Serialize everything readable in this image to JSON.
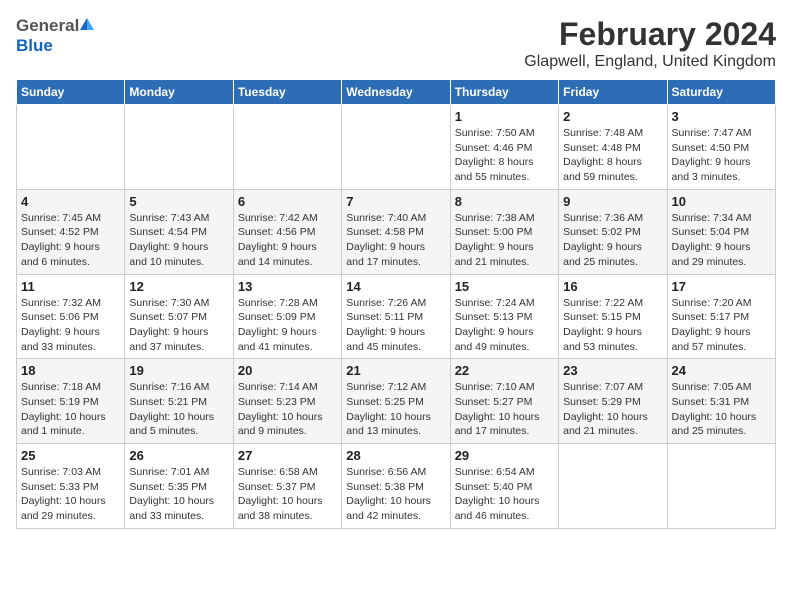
{
  "logo": {
    "general": "General",
    "blue": "Blue"
  },
  "title": "February 2024",
  "subtitle": "Glapwell, England, United Kingdom",
  "weekdays": [
    "Sunday",
    "Monday",
    "Tuesday",
    "Wednesday",
    "Thursday",
    "Friday",
    "Saturday"
  ],
  "weeks": [
    [
      {
        "day": "",
        "info": ""
      },
      {
        "day": "",
        "info": ""
      },
      {
        "day": "",
        "info": ""
      },
      {
        "day": "",
        "info": ""
      },
      {
        "day": "1",
        "info": "Sunrise: 7:50 AM\nSunset: 4:46 PM\nDaylight: 8 hours\nand 55 minutes."
      },
      {
        "day": "2",
        "info": "Sunrise: 7:48 AM\nSunset: 4:48 PM\nDaylight: 8 hours\nand 59 minutes."
      },
      {
        "day": "3",
        "info": "Sunrise: 7:47 AM\nSunset: 4:50 PM\nDaylight: 9 hours\nand 3 minutes."
      }
    ],
    [
      {
        "day": "4",
        "info": "Sunrise: 7:45 AM\nSunset: 4:52 PM\nDaylight: 9 hours\nand 6 minutes."
      },
      {
        "day": "5",
        "info": "Sunrise: 7:43 AM\nSunset: 4:54 PM\nDaylight: 9 hours\nand 10 minutes."
      },
      {
        "day": "6",
        "info": "Sunrise: 7:42 AM\nSunset: 4:56 PM\nDaylight: 9 hours\nand 14 minutes."
      },
      {
        "day": "7",
        "info": "Sunrise: 7:40 AM\nSunset: 4:58 PM\nDaylight: 9 hours\nand 17 minutes."
      },
      {
        "day": "8",
        "info": "Sunrise: 7:38 AM\nSunset: 5:00 PM\nDaylight: 9 hours\nand 21 minutes."
      },
      {
        "day": "9",
        "info": "Sunrise: 7:36 AM\nSunset: 5:02 PM\nDaylight: 9 hours\nand 25 minutes."
      },
      {
        "day": "10",
        "info": "Sunrise: 7:34 AM\nSunset: 5:04 PM\nDaylight: 9 hours\nand 29 minutes."
      }
    ],
    [
      {
        "day": "11",
        "info": "Sunrise: 7:32 AM\nSunset: 5:06 PM\nDaylight: 9 hours\nand 33 minutes."
      },
      {
        "day": "12",
        "info": "Sunrise: 7:30 AM\nSunset: 5:07 PM\nDaylight: 9 hours\nand 37 minutes."
      },
      {
        "day": "13",
        "info": "Sunrise: 7:28 AM\nSunset: 5:09 PM\nDaylight: 9 hours\nand 41 minutes."
      },
      {
        "day": "14",
        "info": "Sunrise: 7:26 AM\nSunset: 5:11 PM\nDaylight: 9 hours\nand 45 minutes."
      },
      {
        "day": "15",
        "info": "Sunrise: 7:24 AM\nSunset: 5:13 PM\nDaylight: 9 hours\nand 49 minutes."
      },
      {
        "day": "16",
        "info": "Sunrise: 7:22 AM\nSunset: 5:15 PM\nDaylight: 9 hours\nand 53 minutes."
      },
      {
        "day": "17",
        "info": "Sunrise: 7:20 AM\nSunset: 5:17 PM\nDaylight: 9 hours\nand 57 minutes."
      }
    ],
    [
      {
        "day": "18",
        "info": "Sunrise: 7:18 AM\nSunset: 5:19 PM\nDaylight: 10 hours\nand 1 minute."
      },
      {
        "day": "19",
        "info": "Sunrise: 7:16 AM\nSunset: 5:21 PM\nDaylight: 10 hours\nand 5 minutes."
      },
      {
        "day": "20",
        "info": "Sunrise: 7:14 AM\nSunset: 5:23 PM\nDaylight: 10 hours\nand 9 minutes."
      },
      {
        "day": "21",
        "info": "Sunrise: 7:12 AM\nSunset: 5:25 PM\nDaylight: 10 hours\nand 13 minutes."
      },
      {
        "day": "22",
        "info": "Sunrise: 7:10 AM\nSunset: 5:27 PM\nDaylight: 10 hours\nand 17 minutes."
      },
      {
        "day": "23",
        "info": "Sunrise: 7:07 AM\nSunset: 5:29 PM\nDaylight: 10 hours\nand 21 minutes."
      },
      {
        "day": "24",
        "info": "Sunrise: 7:05 AM\nSunset: 5:31 PM\nDaylight: 10 hours\nand 25 minutes."
      }
    ],
    [
      {
        "day": "25",
        "info": "Sunrise: 7:03 AM\nSunset: 5:33 PM\nDaylight: 10 hours\nand 29 minutes."
      },
      {
        "day": "26",
        "info": "Sunrise: 7:01 AM\nSunset: 5:35 PM\nDaylight: 10 hours\nand 33 minutes."
      },
      {
        "day": "27",
        "info": "Sunrise: 6:58 AM\nSunset: 5:37 PM\nDaylight: 10 hours\nand 38 minutes."
      },
      {
        "day": "28",
        "info": "Sunrise: 6:56 AM\nSunset: 5:38 PM\nDaylight: 10 hours\nand 42 minutes."
      },
      {
        "day": "29",
        "info": "Sunrise: 6:54 AM\nSunset: 5:40 PM\nDaylight: 10 hours\nand 46 minutes."
      },
      {
        "day": "",
        "info": ""
      },
      {
        "day": "",
        "info": ""
      }
    ]
  ]
}
